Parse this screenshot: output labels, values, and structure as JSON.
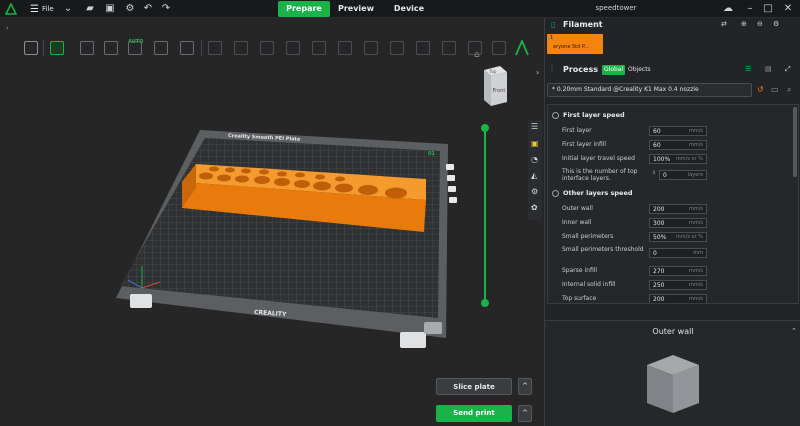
{
  "titlebar": {
    "menu_label": "File",
    "tabs": [
      {
        "label": "Prepare",
        "active": true
      },
      {
        "label": "Preview",
        "active": false
      },
      {
        "label": "Device",
        "active": false
      }
    ],
    "window_title": "speedtower"
  },
  "toolbar": {
    "auto_label": "AUTO"
  },
  "viewport": {
    "cube_top": "Top",
    "cube_front": "Front",
    "plate_header": "Creality Smooth PEI Plate",
    "plate_number": "01",
    "plate_brand": "CREALITY"
  },
  "filament": {
    "title": "Filament",
    "slot_number": "1",
    "slot_name": "eryone Std P...",
    "slot_color": "#f5830d"
  },
  "process": {
    "title": "Process",
    "global_label": "Global",
    "objects_label": "Objects",
    "preset": "* 0.20mm Standard @Creality K1 Max 0.4 nozzle"
  },
  "sections": [
    {
      "title": "First layer speed",
      "rows": [
        {
          "label": "First layer",
          "value": "60",
          "unit": "mm/s"
        },
        {
          "label": "First layer infill",
          "value": "60",
          "unit": "mm/s"
        },
        {
          "label": "Initial layer travel speed",
          "value": "100%",
          "unit": "mm/s or %"
        },
        {
          "label": "This is the number of top interface layers.",
          "value": "0",
          "unit": "layers"
        }
      ]
    },
    {
      "title": "Other layers speed",
      "rows": [
        {
          "label": "Outer wall",
          "value": "200",
          "unit": "mm/s"
        },
        {
          "label": "Inner wall",
          "value": "300",
          "unit": "mm/s"
        },
        {
          "label": "Small perimeters",
          "value": "50%",
          "unit": "mm/s or %"
        },
        {
          "label": "Small perimeters threshold",
          "value": "0",
          "unit": "mm"
        },
        {
          "label": "Sparse infill",
          "value": "270",
          "unit": "mm/s"
        },
        {
          "label": "Internal solid infill",
          "value": "250",
          "unit": "mm/s"
        },
        {
          "label": "Top surface",
          "value": "200",
          "unit": "mm/s"
        }
      ]
    }
  ],
  "preview": {
    "title": "Outer wall"
  },
  "actions": {
    "slice_label": "Slice plate",
    "send_label": "Send print"
  },
  "colors": {
    "accent": "#1ab34a",
    "model": "#f5830d"
  }
}
